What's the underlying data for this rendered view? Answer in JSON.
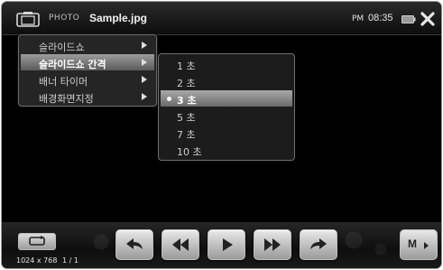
{
  "header": {
    "app_label": "PHOTO",
    "file_name": "Sample.jpg",
    "ampm": "PM",
    "time": "08:35"
  },
  "main_menu": {
    "items": [
      {
        "label": "슬라이드쇼"
      },
      {
        "label": "슬라이드쇼 간격",
        "active": true
      },
      {
        "label": "배너 타이머"
      },
      {
        "label": "배경화면지정"
      }
    ]
  },
  "sub_menu": {
    "items": [
      {
        "label": "1 초"
      },
      {
        "label": "2 초"
      },
      {
        "label": "3 초",
        "selected": true
      },
      {
        "label": "5 초"
      },
      {
        "label": "7 초"
      },
      {
        "label": "10 초"
      }
    ]
  },
  "footer": {
    "resolution": "1024 x 768",
    "page_counter": "1 / 1",
    "mode_label": "M"
  },
  "icons": {
    "photo": "camera-icon",
    "battery": "battery-icon",
    "close": "close-icon",
    "repeat": "repeat-icon",
    "back": "back-arrow-icon",
    "rewind": "rewind-icon",
    "play": "play-icon",
    "fast_forward": "fast-forward-icon",
    "forward": "forward-arrow-icon"
  },
  "colors": {
    "background": "#000000",
    "menu_highlight": "#8a8a8a",
    "text": "#cfcfcf"
  }
}
